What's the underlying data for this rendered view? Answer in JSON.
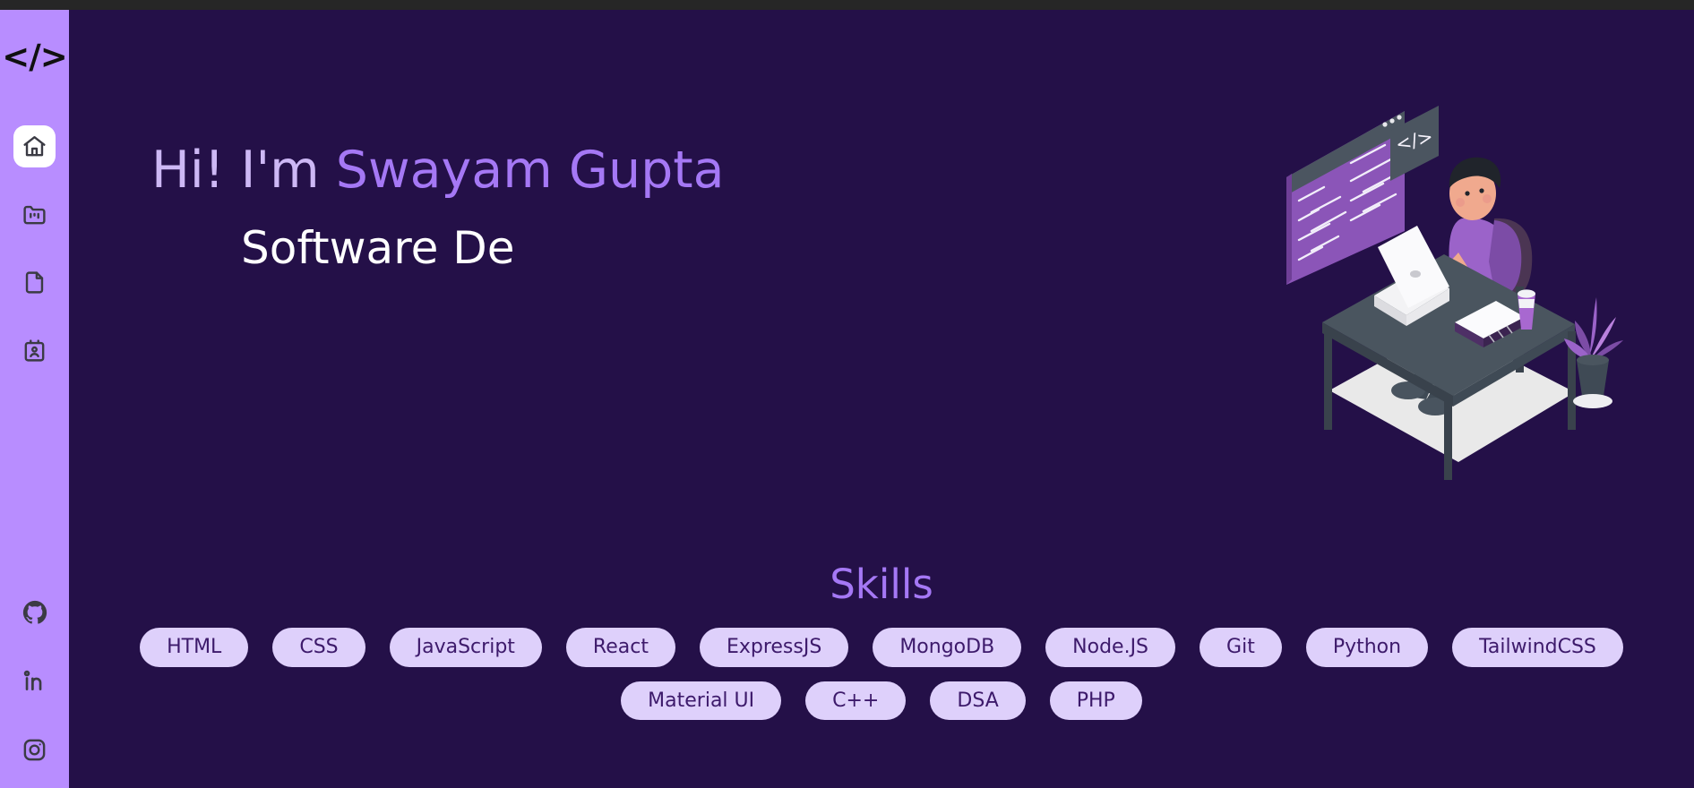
{
  "colors": {
    "background": "#241048",
    "sidebar": "#b88dff",
    "accent_purple": "#a578f5",
    "soft_lavender": "#cdb8f5",
    "pill_background": "#ded0fb",
    "pill_text": "#3d1a6b",
    "white": "#ffffff",
    "top_strip": "#262626"
  },
  "sidebar": {
    "logo": "</>",
    "nav_items": [
      {
        "id": "home",
        "icon": "home-icon",
        "active": true
      },
      {
        "id": "projects",
        "icon": "folder-kanban-icon",
        "active": false
      },
      {
        "id": "resume",
        "icon": "file-icon",
        "active": false
      },
      {
        "id": "contact",
        "icon": "contact-card-icon",
        "active": false
      }
    ],
    "social_items": [
      {
        "id": "github",
        "icon": "github-icon"
      },
      {
        "id": "linkedin",
        "icon": "linkedin-icon"
      },
      {
        "id": "instagram",
        "icon": "instagram-icon"
      }
    ]
  },
  "hero": {
    "greeting_prefix": "Hi! I'm ",
    "name": "Swayam Gupta",
    "role_typing": "Software De",
    "illustration_name": "developer-at-desk-illustration",
    "illustration_code_glyph": "</>"
  },
  "skills": {
    "title": "Skills",
    "items": [
      "HTML",
      "CSS",
      "JavaScript",
      "React",
      "ExpressJS",
      "MongoDB",
      "Node.JS",
      "Git",
      "Python",
      "TailwindCSS",
      "Material UI",
      "C++",
      "DSA",
      "PHP"
    ]
  }
}
